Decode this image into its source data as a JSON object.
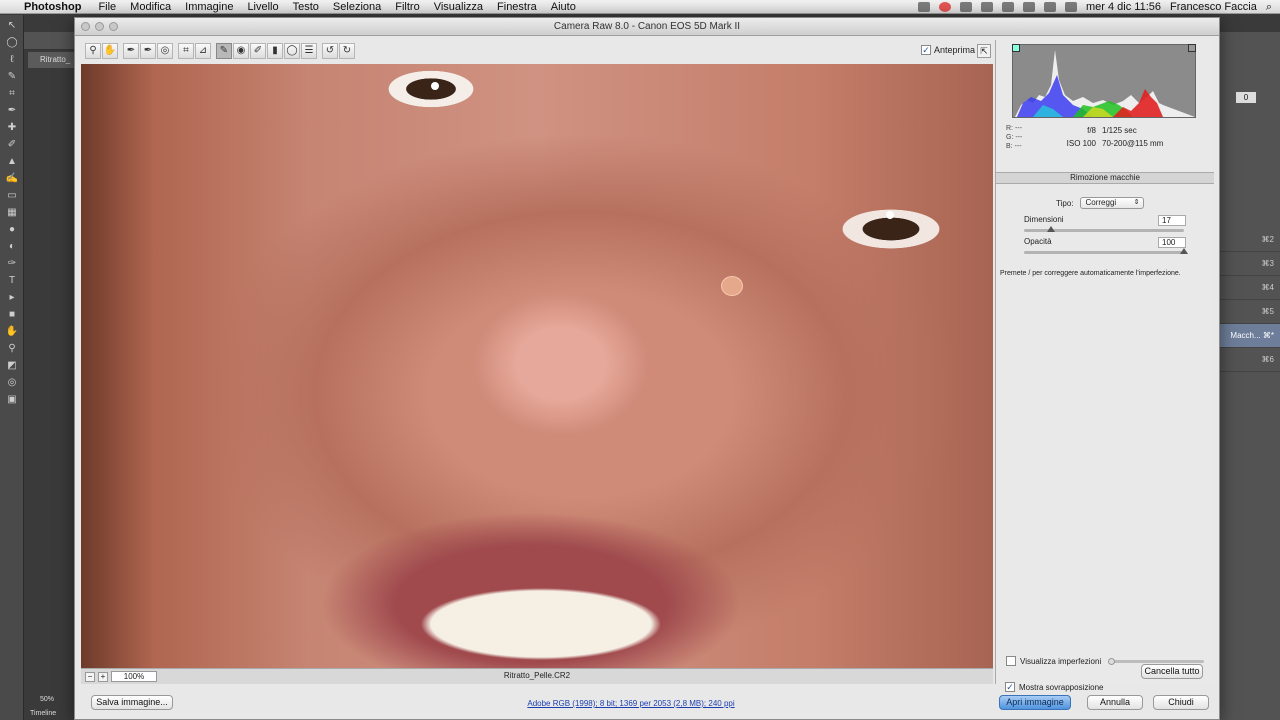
{
  "menubar": {
    "app": "Photoshop",
    "items": [
      "File",
      "Modifica",
      "Immagine",
      "Livello",
      "Testo",
      "Seleziona",
      "Filtro",
      "Visualizza",
      "Finestra",
      "Aiuto"
    ],
    "clock": "mer 4 dic  11:56",
    "user": "Francesco Faccia"
  },
  "photoshop": {
    "doc_tab": "Ritratto_",
    "zoom": "50%",
    "timeline": "Timeline",
    "history_shortcuts": [
      "⌘2",
      "⌘3",
      "⌘4",
      "⌘5",
      "Macch... ⌘*",
      "⌘6"
    ],
    "opt_value": "0"
  },
  "dialog": {
    "title": "Camera Raw 8.0  -  Canon EOS 5D Mark II",
    "preview_label": "Anteprima",
    "preview_checked": true,
    "zoom_value": "100%",
    "filename": "Ritratto_Pelle.CR2",
    "workflow_link": "Adobe RGB (1998); 8 bit; 1369 per 2053 (2,8 MB); 240 ppi",
    "buttons": {
      "save": "Salva immagine...",
      "open": "Apri immagine",
      "cancel": "Annulla",
      "done": "Chiudi"
    }
  },
  "panel": {
    "rgb": {
      "r": "R:  ---",
      "g": "G:  ---",
      "b": "B:  ---"
    },
    "exif": {
      "aperture": "f/8",
      "shutter": "1/125 sec",
      "iso": "ISO 100",
      "lens": "70-200@115 mm"
    },
    "section_title": "Rimozione macchie",
    "type_label": "Tipo:",
    "type_value": "Correggi",
    "size_label": "Dimensioni",
    "size_value": "17",
    "size_fraction": 0.17,
    "opacity_label": "Opacità",
    "opacity_value": "100",
    "opacity_fraction": 1.0,
    "hint": "Premete / per correggere automaticamente l'imperfezione.",
    "visualize_label": "Visualizza imperfezioni",
    "visualize_checked": false,
    "overlay_label": "Mostra sovrapposizione",
    "overlay_checked": true,
    "clear_all": "Cancella tutto"
  },
  "colors": {
    "primary_button": "#4f93de",
    "link": "#1b3fb0",
    "histogram_bg": "#8b8b8b"
  }
}
